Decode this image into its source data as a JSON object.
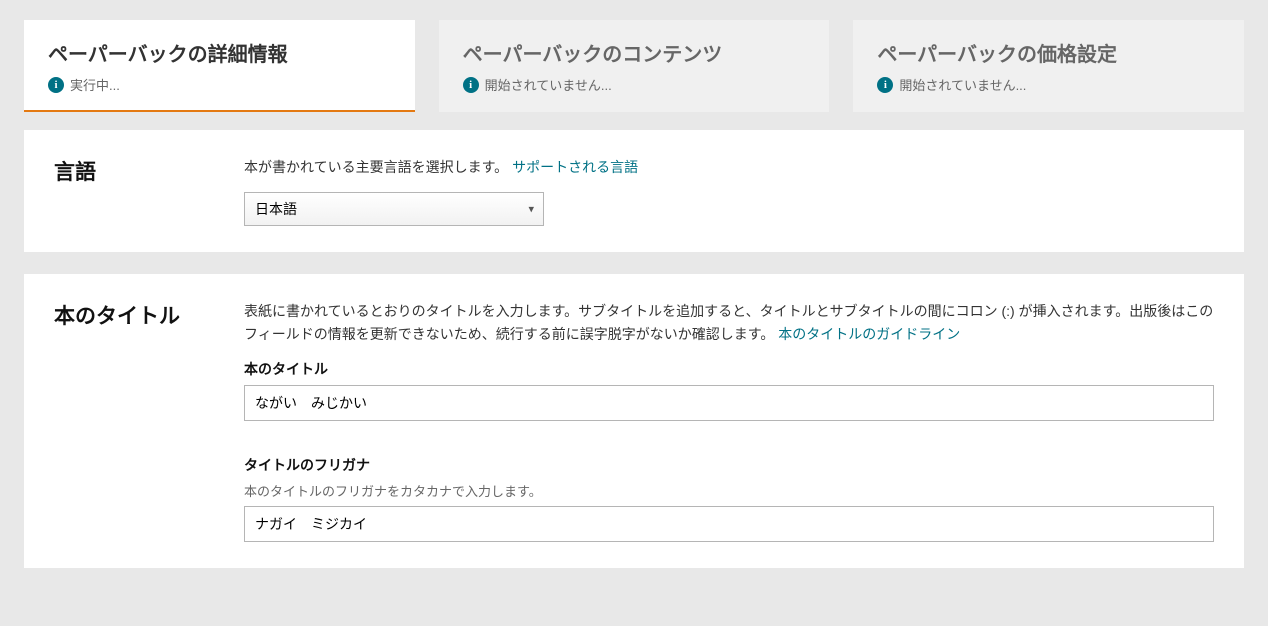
{
  "tabs": [
    {
      "title": "ペーパーバックの詳細情報",
      "status": "実行中..."
    },
    {
      "title": "ペーパーバックのコンテンツ",
      "status": "開始されていません..."
    },
    {
      "title": "ペーパーバックの価格設定",
      "status": "開始されていません..."
    }
  ],
  "language": {
    "section_label": "言語",
    "help": "本が書かれている主要言語を選択します。",
    "link": "サポートされる言語",
    "selected": "日本語"
  },
  "title_section": {
    "section_label": "本のタイトル",
    "help_part1": "表紙に書かれているとおりのタイトルを入力します。サブタイトルを追加すると、タイトルとサブタイトルの間にコロン (:) が挿入されます。出版後はこのフィールドの情報を更新できないため、続行する前に誤字脱字がないか確認します。",
    "help_link": "本のタイトルのガイドライン",
    "title_field_label": "本のタイトル",
    "title_value": "ながい　みじかい",
    "furigana_field_label": "タイトルのフリガナ",
    "furigana_sub": "本のタイトルのフリガナをカタカナで入力します。",
    "furigana_value": "ナガイ　ミジカイ"
  }
}
